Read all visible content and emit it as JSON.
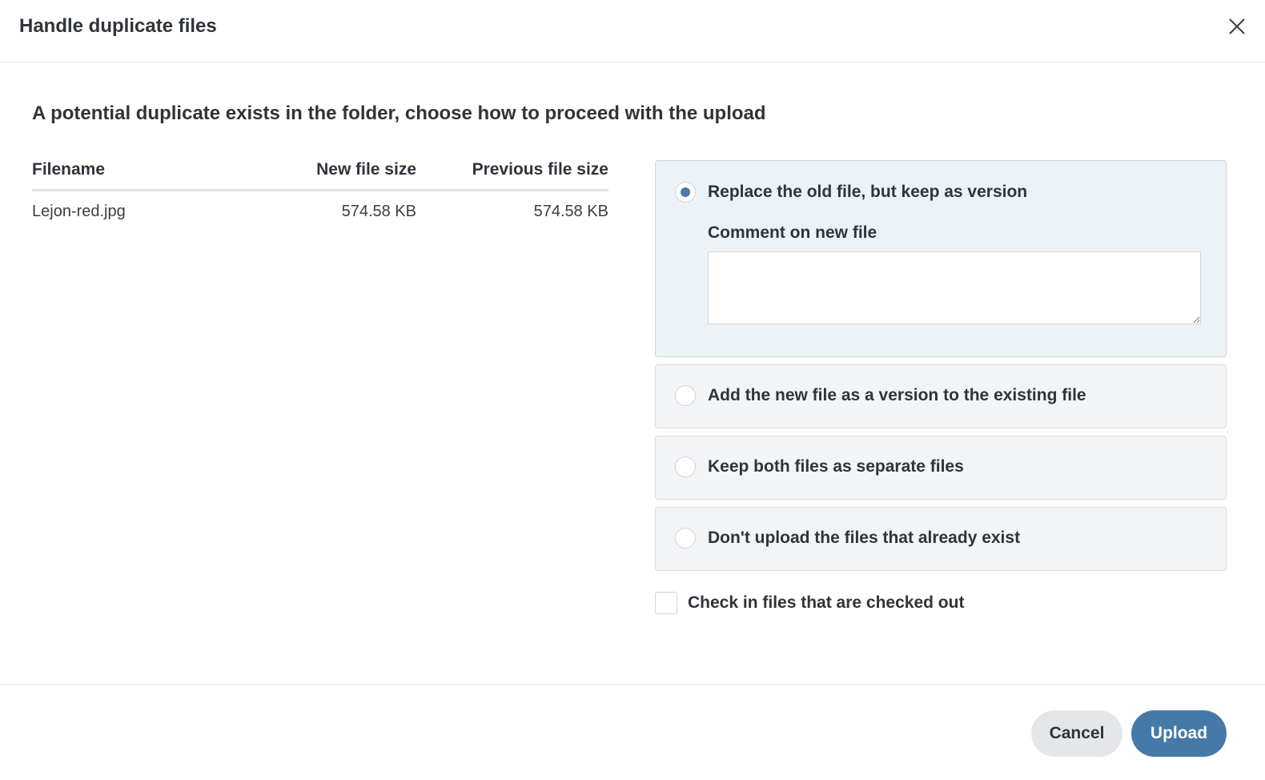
{
  "dialog": {
    "title": "Handle duplicate files",
    "prompt": "A potential duplicate exists in the folder, choose how to proceed with the upload"
  },
  "table": {
    "headers": {
      "filename": "Filename",
      "new_size": "New file size",
      "previous_size": "Previous file size"
    },
    "rows": [
      {
        "filename": "Lejon-red.jpg",
        "new_size": "574.58 KB",
        "previous_size": "574.58 KB"
      }
    ]
  },
  "options": [
    {
      "label": "Replace the old file, but keep as version",
      "selected": true
    },
    {
      "label": "Add the new file as a version to the existing file",
      "selected": false
    },
    {
      "label": "Keep both files as separate files",
      "selected": false
    },
    {
      "label": "Don't upload the files that already exist",
      "selected": false
    }
  ],
  "comment": {
    "label": "Comment on new file",
    "value": "",
    "placeholder": ""
  },
  "checkin": {
    "label": "Check in files that are checked out",
    "checked": false
  },
  "footer": {
    "cancel_label": "Cancel",
    "upload_label": "Upload"
  },
  "colors": {
    "accent": "#457aa8",
    "selected_option_bg": "#edf2f6",
    "option_bg": "#f3f4f6"
  },
  "icons": {
    "close": "close-icon"
  }
}
